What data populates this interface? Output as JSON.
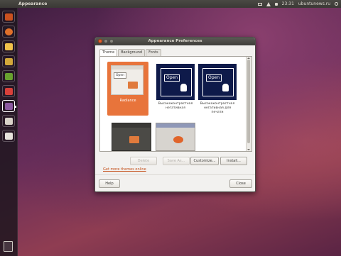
{
  "top_panel": {
    "app_title": "Appearance",
    "clock": "23:31",
    "user": "ubuntunews.ru",
    "icons": [
      "mail-icon",
      "network-icon",
      "volume-icon",
      "power-icon"
    ]
  },
  "launcher": {
    "items": [
      {
        "name": "dash-home-icon",
        "color": "#c9511f"
      },
      {
        "name": "firefox-icon",
        "color": "#e0702a"
      },
      {
        "name": "evolution-icon",
        "color": "#f0c24a"
      },
      {
        "name": "empathy-icon",
        "color": "#d3a83a"
      },
      {
        "name": "shotwell-icon",
        "color": "#68a12f"
      },
      {
        "name": "ubuntu-software-center-icon",
        "color": "#d8403a"
      },
      {
        "name": "appearance-icon",
        "color": "#8c5aa0"
      },
      {
        "name": "files-icon",
        "color": "#d9d4c9"
      },
      {
        "name": "workspace-switcher-icon",
        "color": "#e7e3dc"
      }
    ],
    "trash_icon": "trash-icon"
  },
  "dialog": {
    "title": "Appearance Preferences",
    "tabs": [
      "Theme",
      "Background",
      "Fonts"
    ],
    "active_tab": "Theme",
    "themes": [
      {
        "name": "Radiance",
        "selected": true,
        "preview_open_label": "Open"
      },
      {
        "name": "Высококонтрастная негативная",
        "preview_open_label": "Open"
      },
      {
        "name": "Высококонтрастная негативная для печати",
        "preview_open_label": "Open"
      },
      {
        "name": "",
        "preview_open_label": ""
      },
      {
        "name": "",
        "preview_open_label": ""
      }
    ],
    "buttons": {
      "delete": "Delete",
      "save_as": "Save As...",
      "customize": "Customize...",
      "install": "Install...",
      "help": "Help",
      "close": "Close"
    },
    "more_themes_link": "Get more themes online",
    "colors": {
      "accent": "#e8743b",
      "link": "#c44f1a",
      "high_contrast_bg": "#0e1a4a"
    }
  }
}
